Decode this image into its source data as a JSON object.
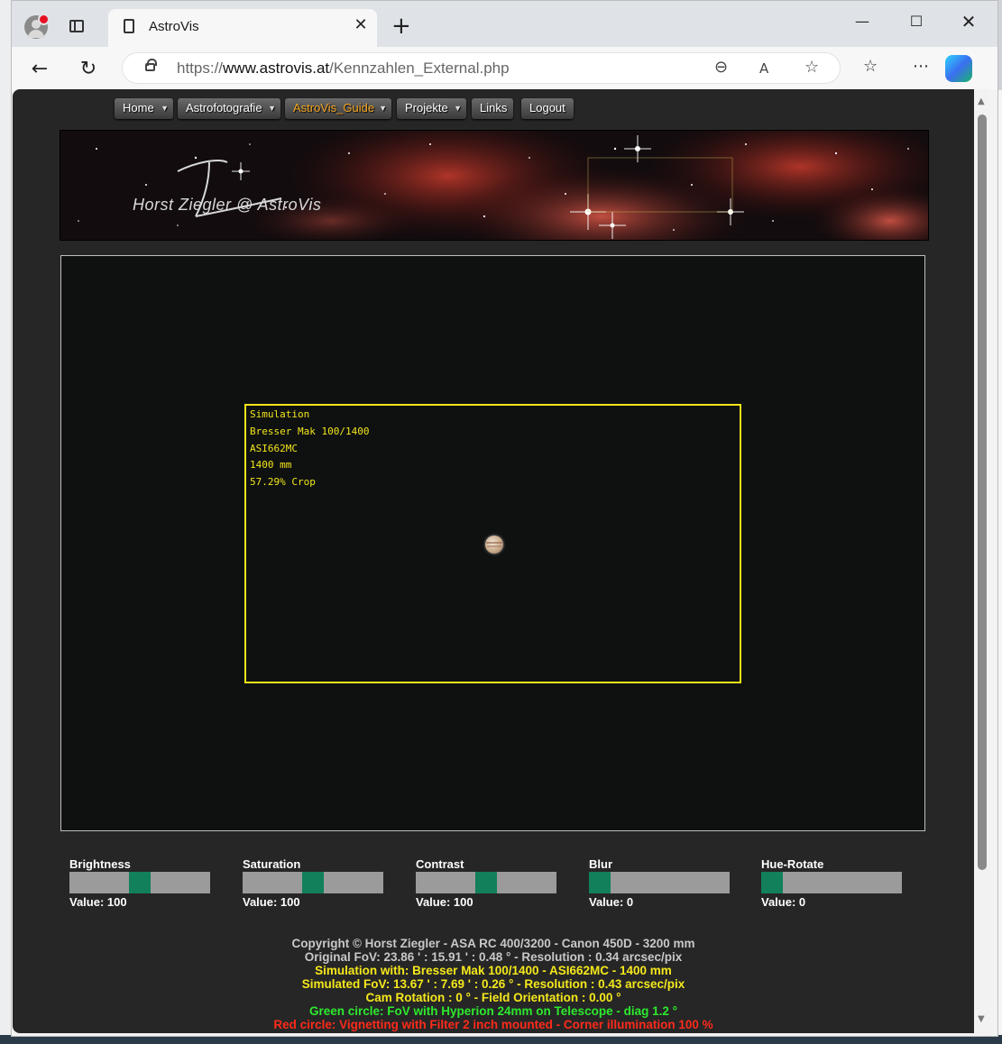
{
  "browser": {
    "tab_title": "AstroVis",
    "url_prefix": "https://",
    "url_domain": "www.astrovis.at",
    "url_path": "/Kennzahlen_External.php"
  },
  "menu": [
    {
      "label": "Home",
      "has_dropdown": true,
      "active": false
    },
    {
      "label": "Astrofotografie",
      "has_dropdown": true,
      "active": false
    },
    {
      "label": "AstroVis_Guide",
      "has_dropdown": true,
      "active": true
    },
    {
      "label": "Projekte",
      "has_dropdown": true,
      "active": false
    },
    {
      "label": "Links",
      "has_dropdown": false,
      "active": false
    },
    {
      "label": "Logout",
      "has_dropdown": false,
      "active": false
    }
  ],
  "banner": {
    "signature": "Horst Ziegler @ AstroVis"
  },
  "simulation": {
    "lines": [
      "Simulation",
      "Bresser Mak 100/1400",
      "ASI662MC",
      "1400 mm",
      "57.29% Crop"
    ],
    "frame_color": "#f2e51b"
  },
  "sliders": [
    {
      "label": "Brightness",
      "value_text": "Value: 100",
      "value": 100
    },
    {
      "label": "Saturation",
      "value_text": "Value: 100",
      "value": 100
    },
    {
      "label": "Contrast",
      "value_text": "Value: 100",
      "value": 100
    },
    {
      "label": "Blur",
      "value_text": "Value: 0",
      "value": 0
    },
    {
      "label": "Hue-Rotate",
      "value_text": "Value: 0",
      "value": 0
    }
  ],
  "footer": {
    "line1": "Copyright © Horst Ziegler - ASA RC 400/3200 - Canon 450D - 3200 mm",
    "line2": "Original FoV: 23.86 ' : 15.91 ' : 0.48 ° - Resolution : 0.34 arcsec/pix",
    "line3": "Simulation with: Bresser Mak 100/1400 - ASI662MC - 1400 mm",
    "line4": "Simulated FoV: 13.67 ' : 7.69 ' : 0.26 ° - Resolution : 0.43 arcsec/pix",
    "line5": "Cam Rotation : 0 ° - Field Orientation : 0.00 °",
    "line6": "Green circle: FoV with Hyperion 24mm on Telescope - diag 1.2 °",
    "line7": "Red circle: Vignetting with Filter 2 inch mounted - Corner illumination 100 %"
  },
  "colors": {
    "accent_menu_active": "#f5a623",
    "slider_thumb": "#12805a",
    "footer_yellow": "#f5e81c",
    "footer_green": "#2ee82e",
    "footer_red": "#ff2a1a"
  }
}
